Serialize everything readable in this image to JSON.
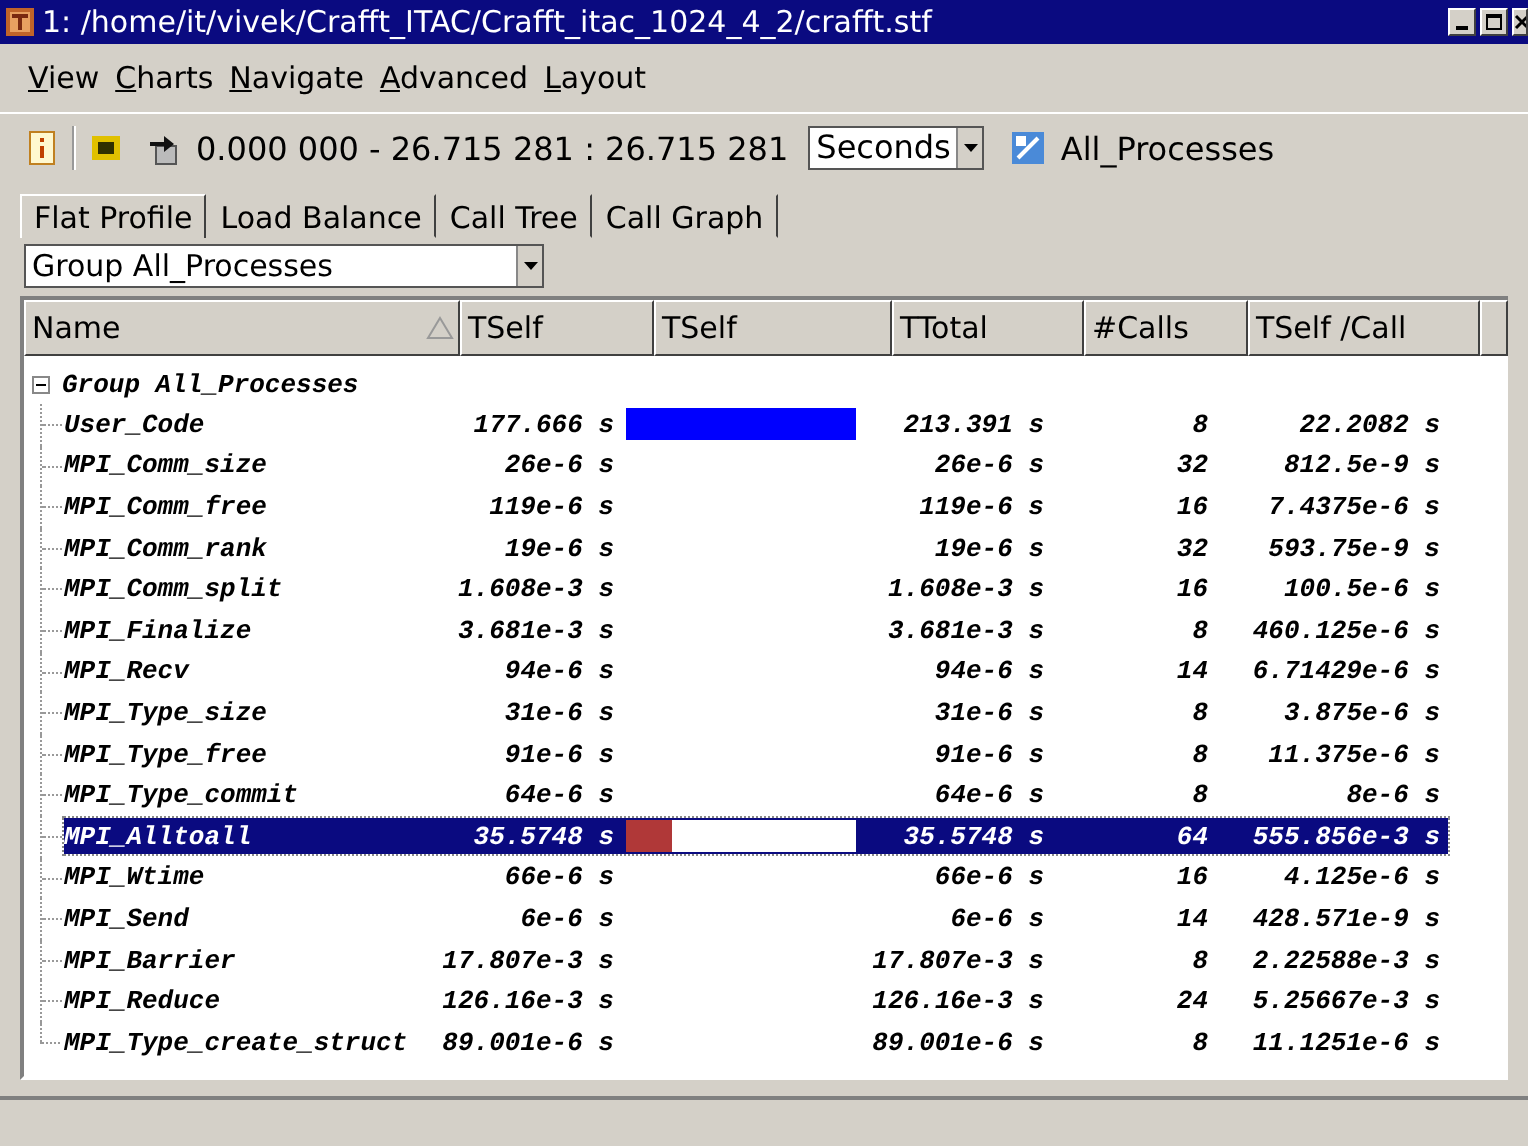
{
  "window": {
    "title": "1: /home/it/vivek/Crafft_ITAC/Crafft_itac_1024_4_2/crafft.stf"
  },
  "menu": [
    "View",
    "Charts",
    "Navigate",
    "Advanced",
    "Layout"
  ],
  "toolbar": {
    "time_range": "0.000 000 - 26.715 281 : 26.715 281",
    "unit": "Seconds",
    "process_filter": "All_Processes"
  },
  "tabs": [
    {
      "label": "Flat Profile",
      "selected": true
    },
    {
      "label": "Load Balance",
      "selected": false
    },
    {
      "label": "Call Tree",
      "selected": false
    },
    {
      "label": "Call Graph",
      "selected": false
    }
  ],
  "grouping": "Group All_Processes",
  "table": {
    "columns": [
      "Name",
      "TSelf",
      "TSelf",
      "TTotal",
      "#Calls",
      "TSelf /Call"
    ],
    "group": {
      "name": "Group All_Processes",
      "expanded": true,
      "children": [
        {
          "name": "User_Code",
          "tself": "177.666 s",
          "level": 1,
          "ttotal": "213.391 s",
          "calls": "8",
          "tself_per_call": "22.2082 s",
          "selected": false
        },
        {
          "name": "MPI_Comm_size",
          "tself": "26e-6 s",
          "ttotal": "26e-6 s",
          "calls": "32",
          "tself_per_call": "812.5e-9 s",
          "selected": false
        },
        {
          "name": "MPI_Comm_free",
          "tself": "119e-6 s",
          "ttotal": "119e-6 s",
          "calls": "16",
          "tself_per_call": "7.4375e-6 s",
          "selected": false
        },
        {
          "name": "MPI_Comm_rank",
          "tself": "19e-6 s",
          "ttotal": "19e-6 s",
          "calls": "32",
          "tself_per_call": "593.75e-9 s",
          "selected": false
        },
        {
          "name": "MPI_Comm_split",
          "tself": "1.608e-3 s",
          "ttotal": "1.608e-3 s",
          "calls": "16",
          "tself_per_call": "100.5e-6 s",
          "selected": false
        },
        {
          "name": "MPI_Finalize",
          "tself": "3.681e-3 s",
          "ttotal": "3.681e-3 s",
          "calls": "8",
          "tself_per_call": "460.125e-6 s",
          "selected": false
        },
        {
          "name": "MPI_Recv",
          "tself": "94e-6 s",
          "ttotal": "94e-6 s",
          "calls": "14",
          "tself_per_call": "6.71429e-6 s",
          "selected": false
        },
        {
          "name": "MPI_Type_size",
          "tself": "31e-6 s",
          "ttotal": "31e-6 s",
          "calls": "8",
          "tself_per_call": "3.875e-6 s",
          "selected": false
        },
        {
          "name": "MPI_Type_free",
          "tself": "91e-6 s",
          "ttotal": "91e-6 s",
          "calls": "8",
          "tself_per_call": "11.375e-6 s",
          "selected": false
        },
        {
          "name": "MPI_Type_commit",
          "tself": "64e-6 s",
          "ttotal": "64e-6 s",
          "calls": "8",
          "tself_per_call": "8e-6 s",
          "selected": false
        },
        {
          "name": "MPI_Alltoall",
          "tself": "35.5748 s",
          "level": 0.2,
          "ttotal": "35.5748 s",
          "calls": "64",
          "tself_per_call": "555.856e-3 s",
          "selected": true
        },
        {
          "name": "MPI_Wtime",
          "tself": "66e-6 s",
          "ttotal": "66e-6 s",
          "calls": "16",
          "tself_per_call": "4.125e-6 s",
          "selected": false
        },
        {
          "name": "MPI_Send",
          "tself": "6e-6 s",
          "ttotal": "6e-6 s",
          "calls": "14",
          "tself_per_call": "428.571e-9 s",
          "selected": false
        },
        {
          "name": "MPI_Barrier",
          "tself": "17.807e-3 s",
          "ttotal": "17.807e-3 s",
          "calls": "8",
          "tself_per_call": "2.22588e-3 s",
          "selected": false
        },
        {
          "name": "MPI_Reduce",
          "tself": "126.16e-3 s",
          "ttotal": "126.16e-3 s",
          "calls": "24",
          "tself_per_call": "5.25667e-3 s",
          "selected": false
        },
        {
          "name": "MPI_Type_create_struct",
          "tself": "89.001e-6 s",
          "ttotal": "89.001e-6 s",
          "calls": "8",
          "tself_per_call": "11.1251e-6 s",
          "selected": false
        }
      ]
    }
  }
}
